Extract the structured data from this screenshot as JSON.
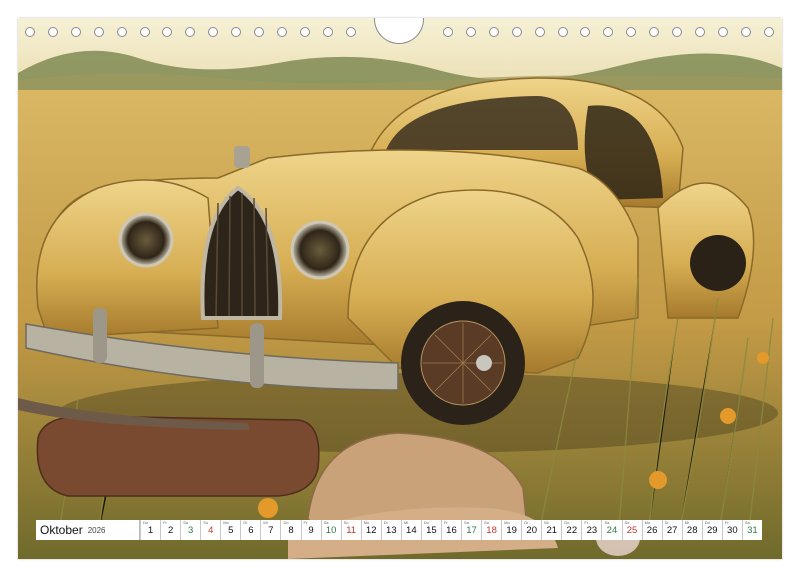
{
  "calendar": {
    "month": "Oktober",
    "year": "2026",
    "days": [
      {
        "n": "1",
        "w": "Do",
        "t": "wd"
      },
      {
        "n": "2",
        "w": "Fr",
        "t": "wd"
      },
      {
        "n": "3",
        "w": "Sa",
        "t": "sat"
      },
      {
        "n": "4",
        "w": "So",
        "t": "sun"
      },
      {
        "n": "5",
        "w": "Mo",
        "t": "wd"
      },
      {
        "n": "6",
        "w": "Di",
        "t": "wd"
      },
      {
        "n": "7",
        "w": "Mi",
        "t": "wd"
      },
      {
        "n": "8",
        "w": "Do",
        "t": "wd"
      },
      {
        "n": "9",
        "w": "Fr",
        "t": "wd"
      },
      {
        "n": "10",
        "w": "Sa",
        "t": "sat"
      },
      {
        "n": "11",
        "w": "So",
        "t": "sun"
      },
      {
        "n": "12",
        "w": "Mo",
        "t": "wd"
      },
      {
        "n": "13",
        "w": "Di",
        "t": "wd"
      },
      {
        "n": "14",
        "w": "Mi",
        "t": "wd"
      },
      {
        "n": "15",
        "w": "Do",
        "t": "wd"
      },
      {
        "n": "16",
        "w": "Fr",
        "t": "wd"
      },
      {
        "n": "17",
        "w": "Sa",
        "t": "sat"
      },
      {
        "n": "18",
        "w": "So",
        "t": "sun"
      },
      {
        "n": "19",
        "w": "Mo",
        "t": "wd"
      },
      {
        "n": "20",
        "w": "Di",
        "t": "wd"
      },
      {
        "n": "21",
        "w": "Mi",
        "t": "wd"
      },
      {
        "n": "22",
        "w": "Do",
        "t": "wd"
      },
      {
        "n": "23",
        "w": "Fr",
        "t": "wd"
      },
      {
        "n": "24",
        "w": "Sa",
        "t": "sat"
      },
      {
        "n": "25",
        "w": "So",
        "t": "sun"
      },
      {
        "n": "26",
        "w": "Mo",
        "t": "wd"
      },
      {
        "n": "27",
        "w": "Di",
        "t": "wd"
      },
      {
        "n": "28",
        "w": "Mi",
        "t": "wd"
      },
      {
        "n": "29",
        "w": "Do",
        "t": "wd"
      },
      {
        "n": "30",
        "w": "Fr",
        "t": "wd"
      },
      {
        "n": "31",
        "w": "Sa",
        "t": "sat"
      }
    ],
    "colors": {
      "weekday": "#111111",
      "saturday": "#2e7a46",
      "sunday": "#c0392b"
    }
  },
  "photo": {
    "icon": "vintage-car-photo"
  }
}
